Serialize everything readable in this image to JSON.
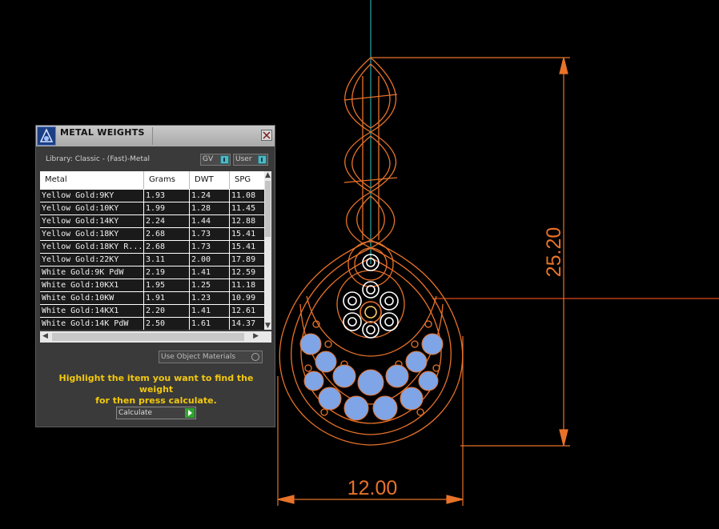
{
  "dimensions": {
    "height_label": "25.20",
    "width_label": "12.00"
  },
  "colors": {
    "background": "#000000",
    "drawing_lines": "#e8722a",
    "gem_fill": "#7fa5e6",
    "axis_line": "#2aa7a7",
    "hint_text": "#f2c80f"
  },
  "dialog": {
    "title": "METAL WEIGHTS",
    "library_label": "Library: Classic - (Fast)-Metal",
    "gv_label": "GV",
    "user_label": "User",
    "columns": [
      "Metal",
      "Grams",
      "DWT",
      "SPG"
    ],
    "rows": [
      [
        "Yellow Gold:9KY",
        "1.93",
        "1.24",
        "11.08"
      ],
      [
        "Yellow Gold:10KY",
        "1.99",
        "1.28",
        "11.45"
      ],
      [
        "Yellow Gold:14KY",
        "2.24",
        "1.44",
        "12.88"
      ],
      [
        "Yellow Gold:18KY",
        "2.68",
        "1.73",
        "15.41"
      ],
      [
        "Yellow Gold:18KY R...",
        "2.68",
        "1.73",
        "15.41"
      ],
      [
        "Yellow Gold:22KY",
        "3.11",
        "2.00",
        "17.89"
      ],
      [
        "White Gold:9K PdW",
        "2.19",
        "1.41",
        "12.59"
      ],
      [
        "White Gold:10KX1",
        "1.95",
        "1.25",
        "11.18"
      ],
      [
        "White Gold:10KW",
        "1.91",
        "1.23",
        "10.99"
      ],
      [
        "White Gold:14KX1",
        "2.20",
        "1.41",
        "12.61"
      ],
      [
        "White Gold:14K PdW",
        "2.50",
        "1.61",
        "14.37"
      ]
    ],
    "use_object_materials_label": "Use Object Materials",
    "hint_line1": "Highlight the item you want to find the weight",
    "hint_line2": "for then press calculate.",
    "calculate_label": "Calculate"
  }
}
